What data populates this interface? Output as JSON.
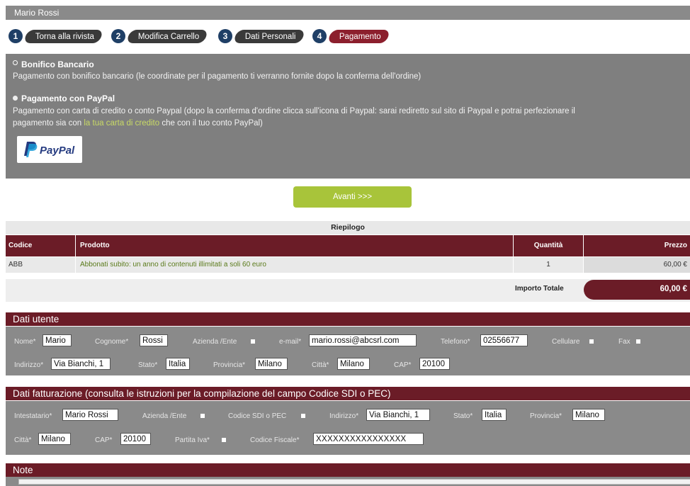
{
  "user": {
    "name": "Mario Rossi"
  },
  "steps": [
    {
      "num": "1",
      "label": "Torna alla rivista"
    },
    {
      "num": "2",
      "label": "Modifica Carrello"
    },
    {
      "num": "3",
      "label": "Dati Personali"
    },
    {
      "num": "4",
      "label": "Pagamento"
    }
  ],
  "payment": {
    "bonifico": {
      "title": "Bonifico Bancario",
      "desc": "Pagamento con bonifico bancario (le coordinate per il pagamento ti verranno fornite dopo la conferma dell'ordine)"
    },
    "paypal": {
      "title": "Pagamento con PayPal",
      "desc1": "Pagamento con carta di credito o conto Paypal (dopo la conferma d'ordine clicca sull'icona di Paypal: sarai rediretto sul sito di Paypal e potrai perfezionare il",
      "desc2_pre": "pagamento sia con ",
      "desc2_link": "la tua carta di credito",
      "desc2_post": " che con il tuo conto PayPal)",
      "logo_text": "PayPal"
    }
  },
  "buttons": {
    "avanti": "Avanti >>>"
  },
  "summary": {
    "title": "Riepilogo",
    "headers": {
      "code": "Codice",
      "product": "Prodotto",
      "qty": "Quantità",
      "price": "Prezzo"
    },
    "row": {
      "code": "ABB",
      "product": "Abbonati subito: un anno di contenuti illimitati a soli 60 euro",
      "qty": "1",
      "price": "60,00 €"
    },
    "total_label": "Importo Totale",
    "total_value": "60,00 €"
  },
  "user_data": {
    "title": "Dati utente",
    "nome_label": "Nome*",
    "nome": "Mario",
    "cognome_label": "Cognome*",
    "cognome": "Rossi",
    "azienda_label": "Azienda /Ente",
    "email_label": "e-mail*",
    "email": "mario.rossi@abcsrl.com",
    "telefono_label": "Telefono*",
    "telefono": "02556677",
    "cellulare_label": "Cellulare",
    "fax_label": "Fax",
    "indirizzo_label": "Indirizzo*",
    "indirizzo": "Via Bianchi, 1",
    "stato_label": "Stato*",
    "stato": "Italia",
    "provincia_label": "Provincia*",
    "provincia": "Milano",
    "citta_label": "Città*",
    "citta": "Milano",
    "cap_label": "CAP*",
    "cap": "20100"
  },
  "billing": {
    "title": "Dati fatturazione (consulta le istruzioni per la compilazione del campo Codice SDI o PEC)",
    "intestatario_label": "Intestatario*",
    "intestatario": "Mario Rossi",
    "azienda_label": "Azienda /Ente",
    "sdi_label": "Codice SDI o PEC",
    "indirizzo_label": "Indirizzo*",
    "indirizzo": "Via Bianchi, 1",
    "stato_label": "Stato*",
    "stato": "Italia",
    "provincia_label": "Provincia*",
    "provincia": "Milano",
    "citta_label": "Città*",
    "citta": "Milano",
    "cap_label": "CAP*",
    "cap": "20100",
    "piva_label": "Partita Iva*",
    "cf_label": "Codice Fiscale*",
    "cf": "XXXXXXXXXXXXXXXX"
  },
  "note": {
    "title": "Note"
  },
  "colors": {
    "accent": "#6b1c27",
    "step_active": "#8c1f2d",
    "button": "#a8c43a",
    "panel": "#7f7f7f"
  }
}
